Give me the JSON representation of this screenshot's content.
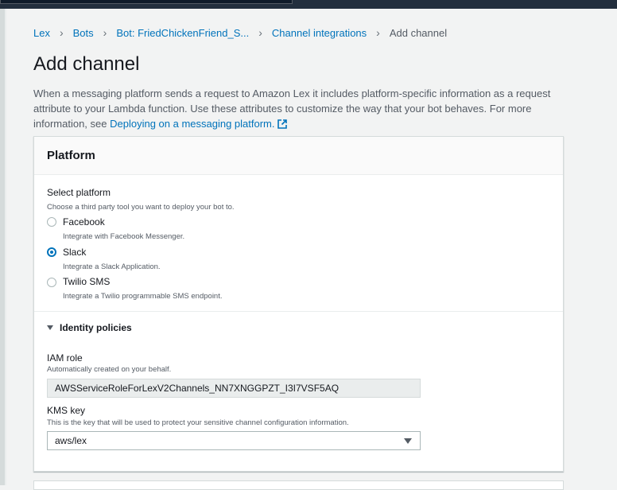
{
  "breadcrumb": {
    "items": [
      "Lex",
      "Bots",
      "Bot: FriedChickenFriend_S...",
      "Channel integrations"
    ],
    "current": "Add channel"
  },
  "page": {
    "title": "Add channel",
    "description": "When a messaging platform sends a request to Amazon Lex it includes platform-specific information as a request attribute to your Lambda function. Use these attributes to customize the way that your bot behaves. For more information, see ",
    "link_text": "Deploying on a messaging platform."
  },
  "platform_panel": {
    "title": "Platform",
    "select_label": "Select platform",
    "select_help": "Choose a third party tool you want to deploy your bot to.",
    "options": [
      {
        "label": "Facebook",
        "help": "Integrate with Facebook Messenger.",
        "selected": false
      },
      {
        "label": "Slack",
        "help": "Integrate a Slack Application.",
        "selected": true
      },
      {
        "label": "Twilio SMS",
        "help": "Integrate a Twilio programmable SMS endpoint.",
        "selected": false
      }
    ],
    "identity": {
      "label": "Identity policies",
      "expanded": true,
      "iam_label": "IAM role",
      "iam_help": "Automatically created on your behalf.",
      "iam_value": "AWSServiceRoleForLexV2Channels_NN7XNGGPZT_I3I7VSF5AQ",
      "kms_label": "KMS key",
      "kms_help": "This is the key that will be used to protect your sensitive channel configuration information.",
      "kms_value": "aws/lex"
    }
  },
  "colors": {
    "link": "#0073bb",
    "nav": "#232f3e",
    "background": "#f2f3f3"
  }
}
